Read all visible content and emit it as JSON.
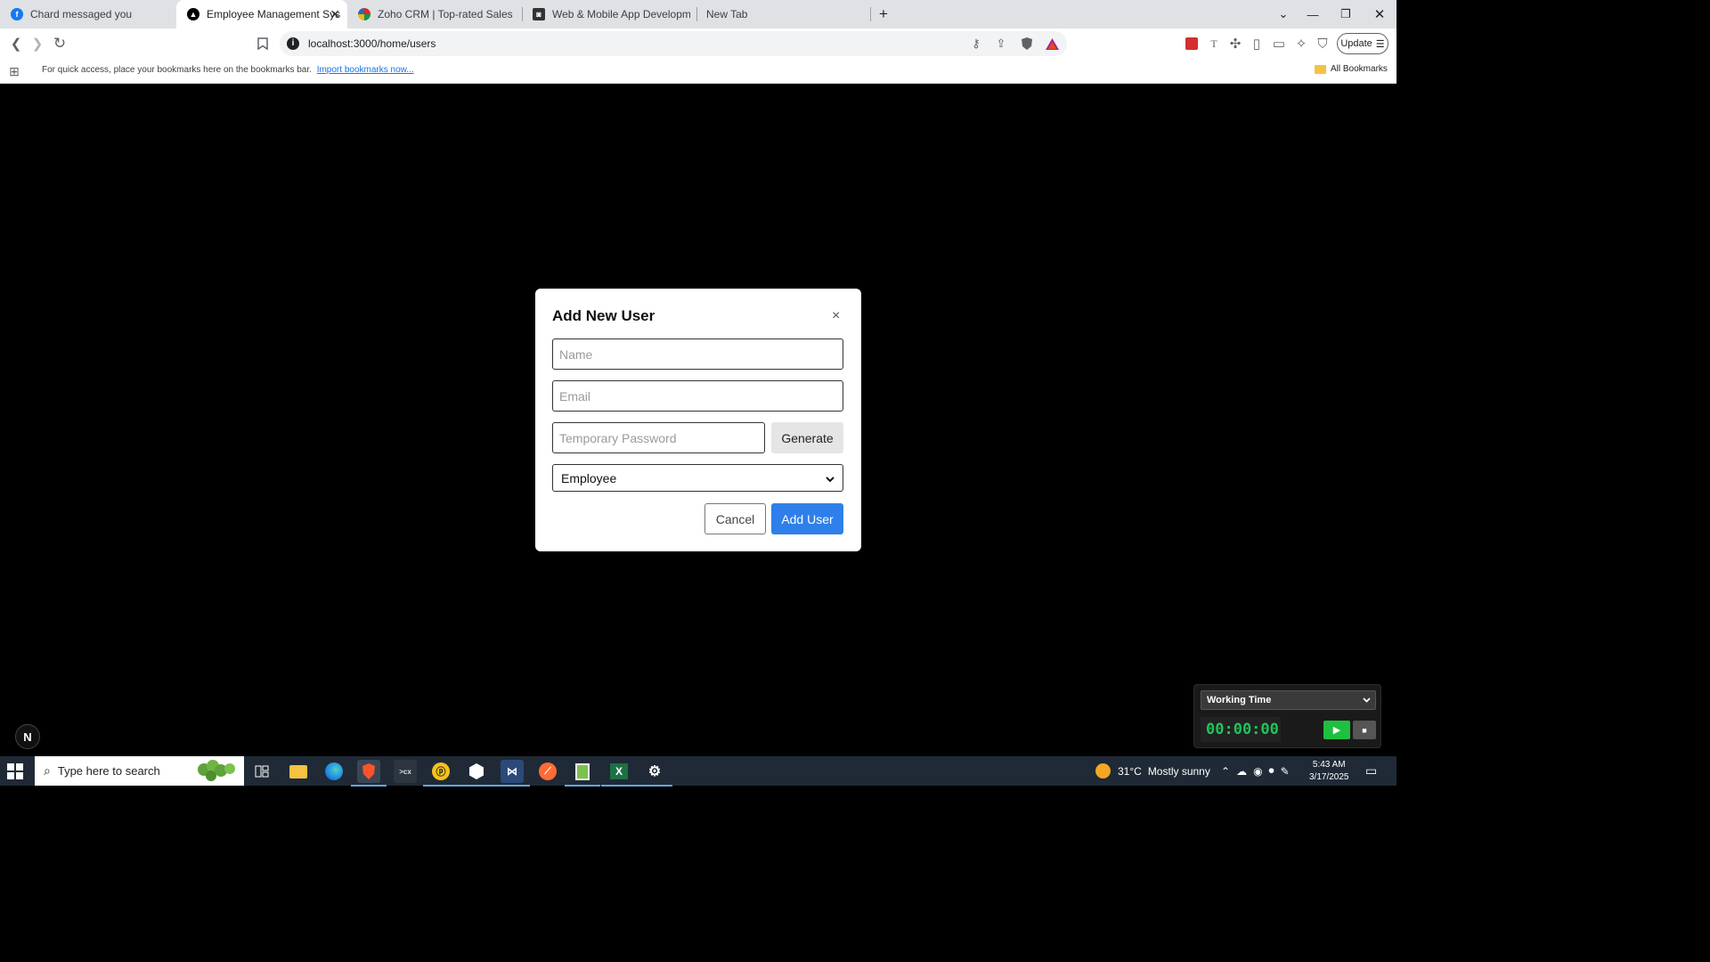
{
  "browser": {
    "tabs": [
      {
        "title": "Chard messaged you",
        "icon": "facebook-icon",
        "color": "#1877f2"
      },
      {
        "title": "Employee Management System",
        "icon": "nextjs-icon",
        "color": "#000000"
      },
      {
        "title": "Zoho CRM | Top-rated Sales CRM So",
        "icon": "zoho-icon",
        "color": "#e42527"
      },
      {
        "title": "Web & Mobile App Development | C",
        "icon": "site-icon",
        "color": "#333333"
      },
      {
        "title": "New Tab",
        "icon": "",
        "color": ""
      }
    ],
    "tab_close": "✕",
    "new_tab": "+",
    "url": "localhost:3000/home/users",
    "update_label": "Update",
    "bookmarks_bar": {
      "message": "For quick access, place your bookmarks here on the bookmarks bar.",
      "import_link": "Import bookmarks now...",
      "all_bookmarks": "All Bookmarks"
    }
  },
  "modal": {
    "title": "Add New User",
    "close": "×",
    "name_placeholder": "Name",
    "email_placeholder": "Email",
    "password_placeholder": "Temporary Password",
    "generate_label": "Generate",
    "role_selected": "Employee",
    "cancel_label": "Cancel",
    "submit_label": "Add User"
  },
  "app_badge": "N",
  "timer": {
    "mode": "Working Time",
    "time": "00:00:00"
  },
  "taskbar": {
    "search_placeholder": "Type here to search",
    "weather_temp": "31°C",
    "weather_desc": "Mostly sunny",
    "time": "5:43 AM",
    "date": "3/17/2025"
  }
}
